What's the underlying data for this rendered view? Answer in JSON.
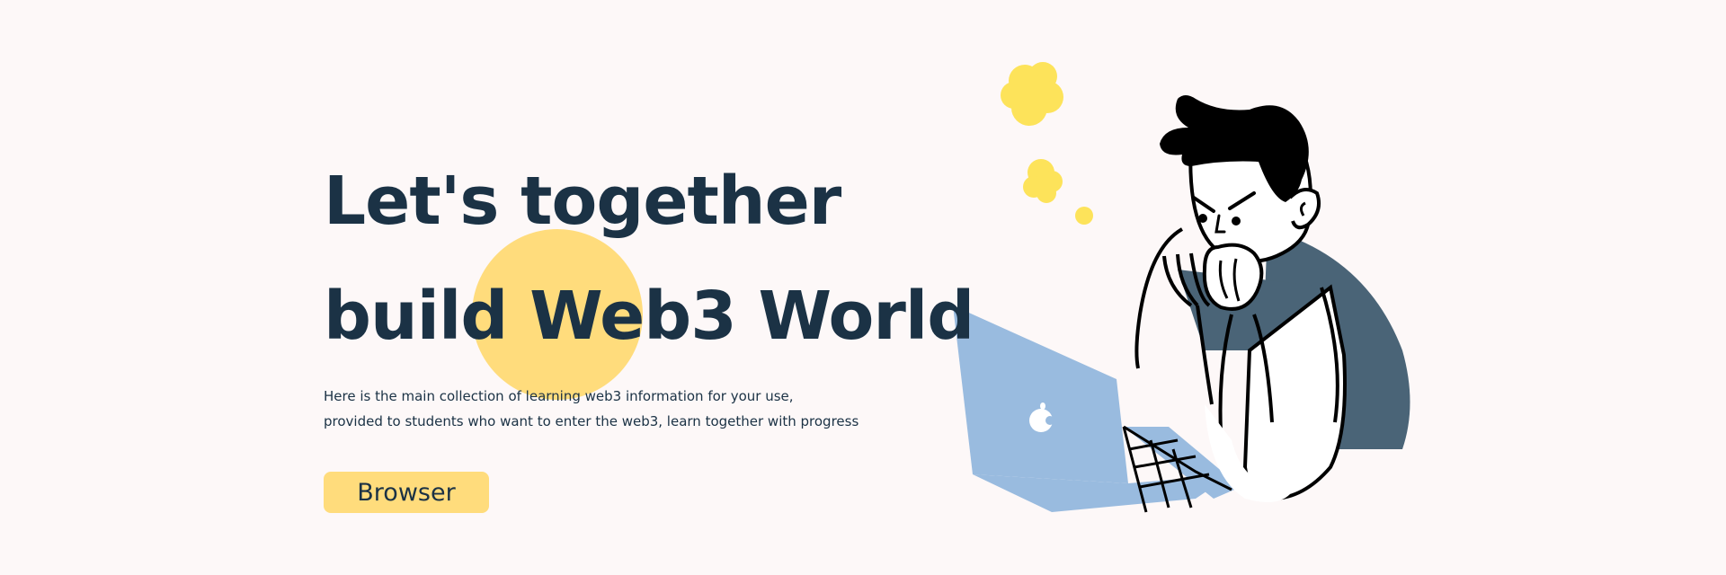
{
  "hero": {
    "headline_line1": "Let's together",
    "headline_line2": "build Web3 World",
    "description_line1": "Here is the main collection of learning web3 information for your use,",
    "description_line2": "provided to students who want to enter the web3, learn together with progress",
    "cta_label": "Browser"
  },
  "colors": {
    "background": "#fdf8f8",
    "text": "#1b3245",
    "accent_yellow": "#ffdc7c",
    "thought_yellow": "#fde35a",
    "laptop_blue": "#99bbdf",
    "shirt_slate": "#4a6477"
  },
  "illustration": {
    "subject": "person-thinking-at-laptop",
    "icons": [
      "thought-bubble-icon",
      "laptop-icon",
      "apple-logo-icon"
    ]
  }
}
